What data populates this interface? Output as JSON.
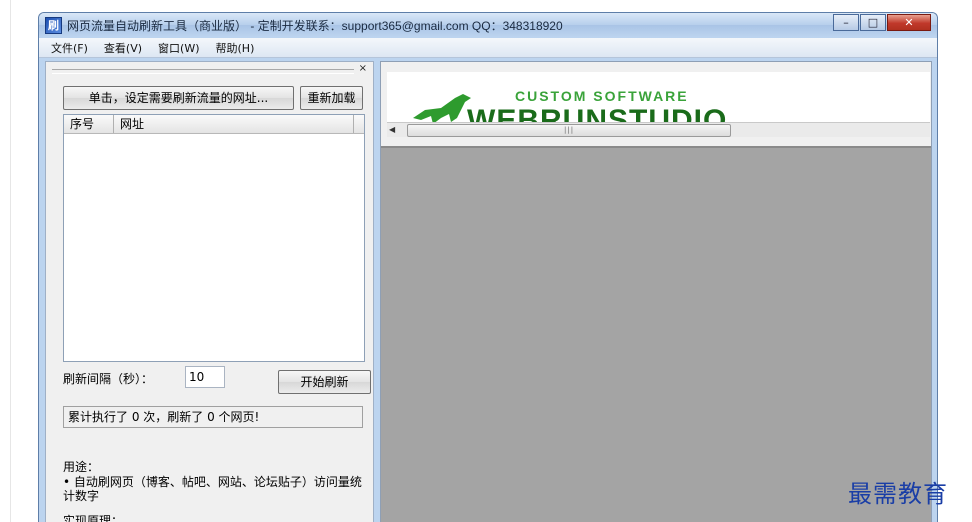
{
  "window": {
    "title": "网页流量自动刷新工具（商业版） - 定制开发联系：support365@gmail.com QQ：348318920",
    "icon": "app-icon"
  },
  "menu": [
    "文件(F)",
    "查看(V)",
    "窗口(W)",
    "帮助(H)"
  ],
  "left_panel": {
    "close_glyph": "×",
    "set_url_button": "单击，设定需要刷新流量的网址...",
    "reload_button": "重新加载",
    "table": {
      "columns": [
        "序号",
        "网址"
      ],
      "rows": []
    },
    "interval_label": "刷新间隔（秒）：",
    "interval_value": "10",
    "start_button": "开始刷新",
    "status_text": "累计执行了 0 次，刷新了 0 个网页!",
    "usage_title": "用途：",
    "usage_item": "• 自动刷网页（博客、帖吧、网站、论坛贴子）访问量统计数字",
    "more_title": "实现原理："
  },
  "browser": {
    "banner_tagline": "CUSTOM SOFTWARE",
    "banner_brand": "WEBRUNSTUDIO",
    "scroll_grip": "|||"
  },
  "watermark": "最需教育"
}
